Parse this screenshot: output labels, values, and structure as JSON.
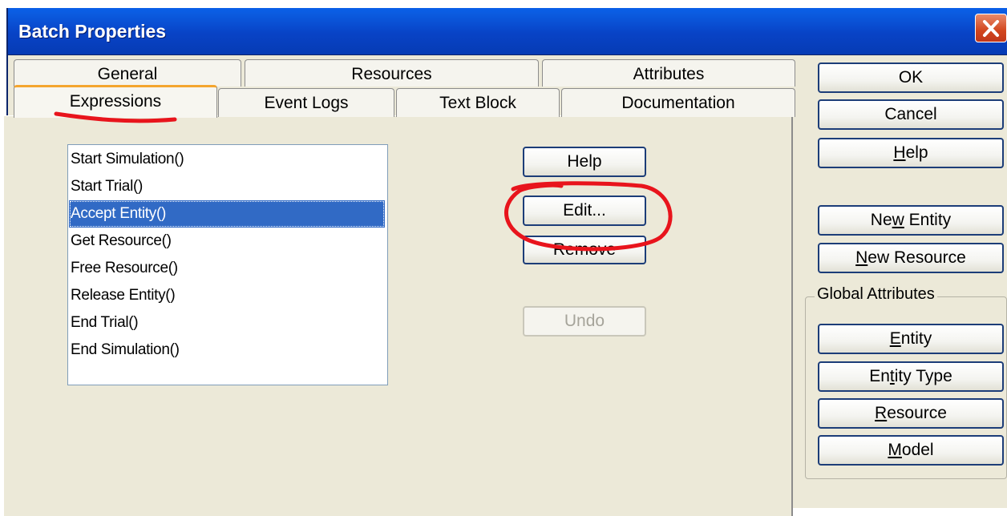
{
  "window": {
    "title": "Batch Properties"
  },
  "tabs": {
    "row1": [
      "General",
      "Resources",
      "Attributes"
    ],
    "row2": [
      "Expressions",
      "Event Logs",
      "Text Block",
      "Documentation"
    ],
    "active": "Expressions"
  },
  "expressions": {
    "items": [
      "Start Simulation()",
      "Start Trial()",
      "Accept Entity()",
      "Get Resource()",
      "Free Resource()",
      "Release Entity()",
      "End Trial()",
      "End Simulation()"
    ],
    "selected_index": 2,
    "buttons": {
      "help": "Help",
      "edit": "Edit...",
      "remove": "Remove",
      "undo": "Undo"
    }
  },
  "side_buttons": {
    "ok": "OK",
    "cancel": "Cancel",
    "help": "Help",
    "new_entity": "New Entity",
    "new_resource": "New Resource"
  },
  "global_attributes": {
    "label": "Global Attributes",
    "buttons": [
      "Entity",
      "Entity Type",
      "Resource",
      "Model"
    ]
  },
  "colors": {
    "title_bar": "#0843c6",
    "selection": "#316ac5",
    "active_tab_accent": "#f4a52e",
    "annotation": "#e8141c"
  }
}
